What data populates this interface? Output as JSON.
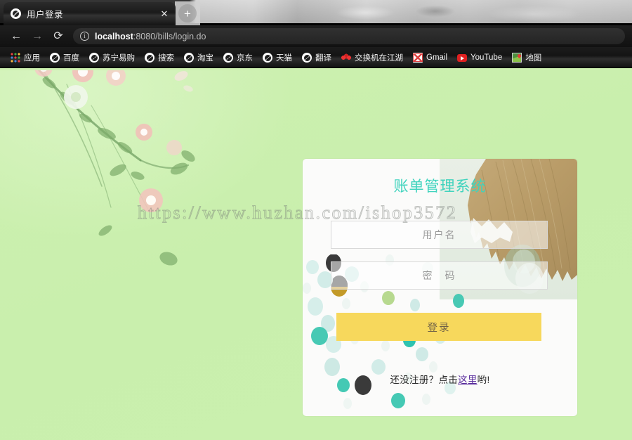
{
  "browser": {
    "tab": {
      "title": "用户登录",
      "favicon": "globe-icon",
      "close_label": "✕"
    },
    "newtab_label": "+",
    "nav": {
      "back_label": "←",
      "forward_label": "→",
      "reload_label": "⟳"
    },
    "omnibox": {
      "info_label": "i",
      "url_host": "localhost",
      "url_rest": ":8080/bills/login.do",
      "full_url": "localhost:8080/bills/login.do"
    },
    "bookmarks": [
      {
        "label": "应用",
        "icon": "apps-grid-icon"
      },
      {
        "label": "百度",
        "icon": "globe-icon"
      },
      {
        "label": "苏宁易购",
        "icon": "globe-icon"
      },
      {
        "label": "搜索",
        "icon": "globe-icon"
      },
      {
        "label": "淘宝",
        "icon": "globe-icon"
      },
      {
        "label": "京东",
        "icon": "globe-icon"
      },
      {
        "label": "天猫",
        "icon": "globe-icon"
      },
      {
        "label": "翻译",
        "icon": "globe-icon"
      },
      {
        "label": "交换机在江湖",
        "icon": "huawei-flower-icon"
      },
      {
        "label": "Gmail",
        "icon": "gmail-icon"
      },
      {
        "label": "YouTube",
        "icon": "youtube-icon"
      },
      {
        "label": "地图",
        "icon": "map-pin-icon"
      }
    ]
  },
  "page": {
    "watermark": "https://www.huzhan.com/ishop3572",
    "login_card": {
      "title": "账单管理系统",
      "username": {
        "placeholder": "用户名",
        "value": ""
      },
      "password": {
        "placeholder": "密　码",
        "value": ""
      },
      "submit_label": "登录",
      "register": {
        "prefix": "还没注册？点击",
        "link_label": "这里",
        "suffix": "哟!"
      }
    }
  },
  "colors": {
    "page_background": "#cdf0b0",
    "card_background": "#fbfbfa",
    "title_teal": "#3fd3bd",
    "button_yellow": "#f7d85c",
    "link_purple": "#5b2f9e",
    "chrome_dark": "#141414"
  }
}
